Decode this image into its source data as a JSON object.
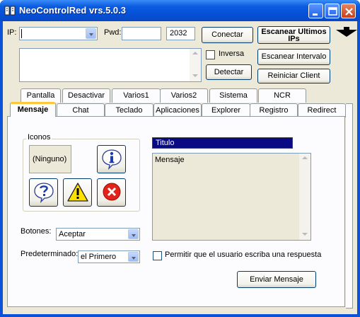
{
  "window": {
    "title": "NeoControlRed vrs.5.0.3"
  },
  "connection": {
    "ip_label": "IP:",
    "ip_value": "",
    "pwd_label": "Pwd:",
    "pwd_value": "",
    "port_value": "2032",
    "connect_button": "Conectar",
    "inverse_label": "Inversa",
    "detect_button": "Detectar",
    "scan_ips_button_line1": "Escanear Ultimos",
    "scan_ips_button_line2": "IPs",
    "scan_interval_button": "Escanear Intervalo",
    "restart_client_button": "Reiniciar Client"
  },
  "tabs_row1": [
    "Pantalla",
    "Desactivar",
    "Varios1",
    "Varios2",
    "Sistema",
    "NCR"
  ],
  "tabs_row2": [
    "Mensaje",
    "Chat",
    "Teclado",
    "Aplicaciones",
    "Explorer",
    "Registro",
    "Redirect"
  ],
  "active_tab": "Mensaje",
  "message_tab": {
    "icons_group_label": "Iconos",
    "selected_icon_label": "(Ninguno)",
    "title_value": "Titulo",
    "message_value": "Mensaje",
    "buttons_label": "Botones:",
    "buttons_value": "Aceptar",
    "default_label": "Predeterminado:",
    "default_value": "el Primero",
    "allow_reply_label": "Permitir que el usuario escriba una respuesta",
    "send_button": "Enviar Mensaje"
  },
  "colors": {
    "title_bar": "#0550d6",
    "face": "#ece9d8",
    "selection": "#0a0a84"
  }
}
